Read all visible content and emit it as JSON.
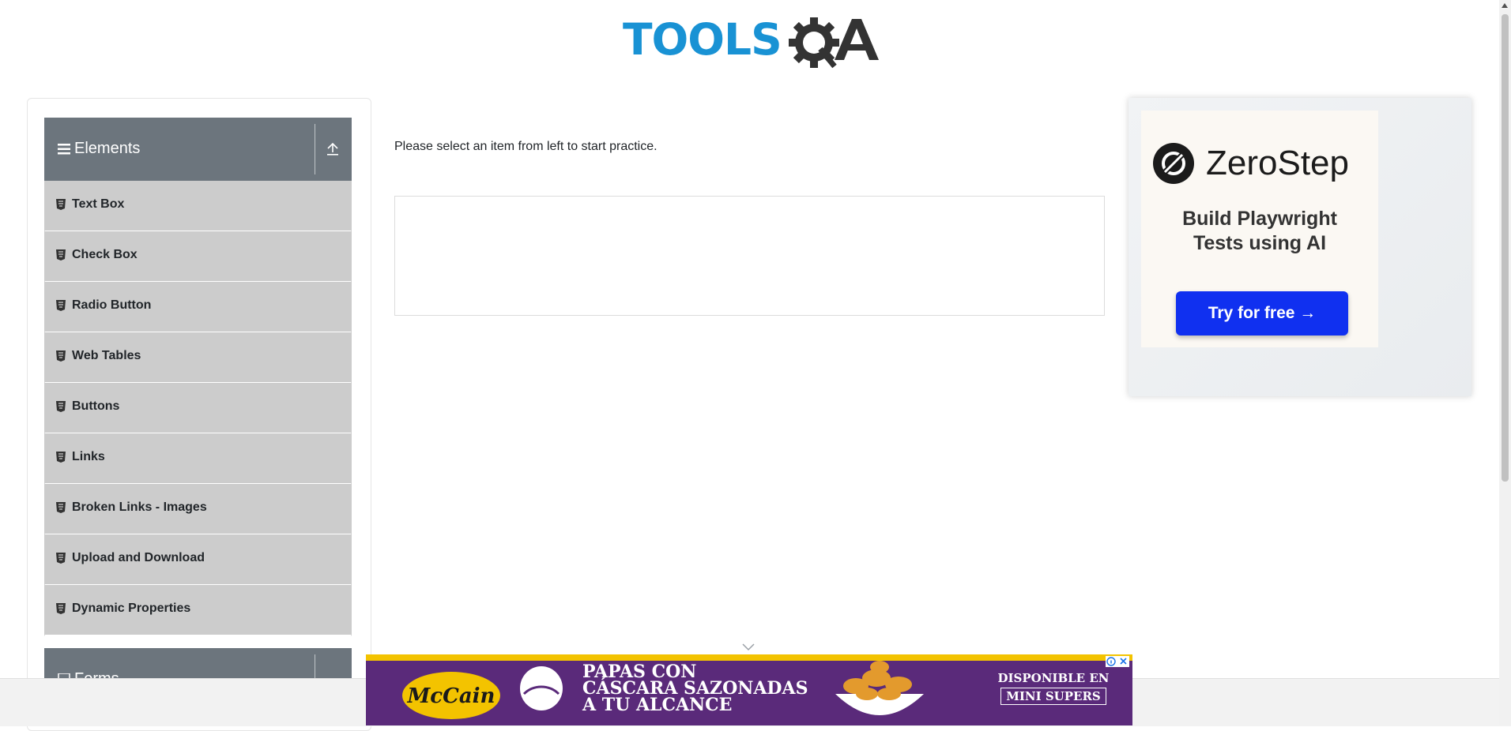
{
  "header": {
    "logo_word": "TOOLS",
    "logo_suffix": "QA"
  },
  "sidebar": {
    "groups": [
      {
        "title": "Elements",
        "items": [
          {
            "label": "Text Box"
          },
          {
            "label": "Check Box"
          },
          {
            "label": "Radio Button"
          },
          {
            "label": "Web Tables"
          },
          {
            "label": "Buttons"
          },
          {
            "label": "Links"
          },
          {
            "label": "Broken Links - Images"
          },
          {
            "label": "Upload and Download"
          },
          {
            "label": "Dynamic Properties"
          }
        ]
      },
      {
        "title": "Forms"
      }
    ]
  },
  "main": {
    "prompt": "Please select an item from left to start practice."
  },
  "ad_right": {
    "brand": "ZeroStep",
    "headline_line1": "Build Playwright",
    "headline_line2": "Tests using AI",
    "cta": "Try for free →",
    "cta_color": "#1030f0"
  },
  "ad_bottom": {
    "brand": "McCain",
    "headline_line1": "PAPAS CON",
    "headline_line2": "CÁSCARA SAZONADAS",
    "headline_line3": "A TU ALCANCE",
    "availability_line1": "DISPONIBLE EN",
    "availability_line2": "MINI SUPERS",
    "background_color": "#5a2a7a"
  },
  "colors": {
    "logo_blue": "#1992d4",
    "group_header": "#6c757d",
    "menu_item_bg": "#cccccc"
  },
  "icons": {
    "menu": "hamburger-icon",
    "toggle": "arrow-up-icon",
    "item": "html5-icon"
  }
}
